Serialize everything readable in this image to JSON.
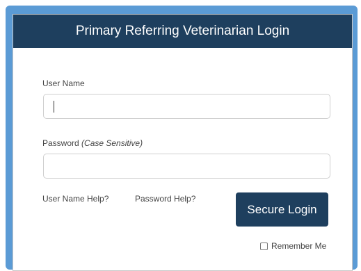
{
  "header": {
    "title": "Primary Referring Veterinarian Login"
  },
  "form": {
    "username_label": "User Name",
    "password_label": "Password",
    "password_hint": "(Case Sensitive)",
    "username_value": "",
    "password_value": ""
  },
  "links": {
    "username_help": "User Name Help?",
    "password_help": "Password Help?"
  },
  "actions": {
    "login_label": "Secure Login",
    "remember_label": "Remember Me",
    "remember_checked": false
  },
  "colors": {
    "header_bg": "#1e3f5e",
    "frame_accent": "#5b9bd5",
    "button_bg": "#1e3f5e"
  }
}
